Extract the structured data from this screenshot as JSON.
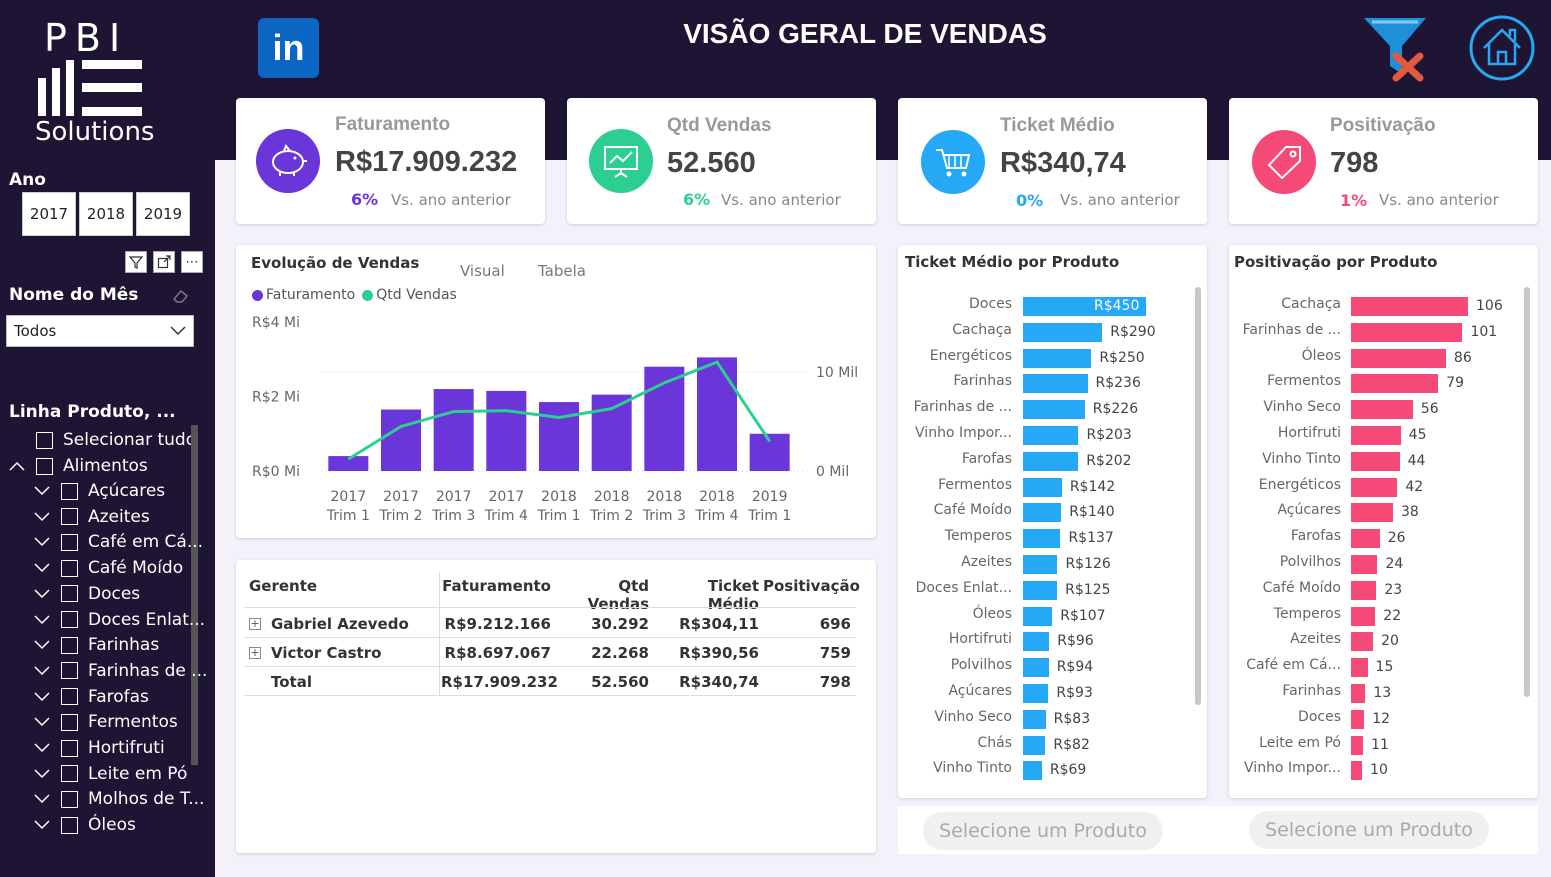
{
  "sidebar": {
    "logo_top": "PBI",
    "logo_bottom": "Solutions",
    "year_label": "Ano",
    "years": [
      "2017",
      "2018",
      "2019"
    ],
    "month_label": "Nome do Mês",
    "month_value": "Todos",
    "product_label": "Linha Produto, ...",
    "select_all": "Selecionar tudo",
    "group": "Alimentos",
    "items": [
      "Açúcares",
      "Azeites",
      "Café em Cá...",
      "Café Moído",
      "Doces",
      "Doces Enlat...",
      "Farinhas",
      "Farinhas de ...",
      "Farofas",
      "Fermentos",
      "Hortifruti",
      "Leite em Pó",
      "Molhos de T...",
      "Óleos"
    ]
  },
  "header": {
    "linkedin": "in",
    "title": "VISÃO GERAL DE VENDAS"
  },
  "kpis": [
    {
      "title": "Faturamento",
      "value": "R$17.909.232",
      "pct": "6%",
      "vs": "Vs. ano anterior",
      "color": "#6a35d9",
      "icon": "piggy-bank-icon"
    },
    {
      "title": "Qtd Vendas",
      "value": "52.560",
      "pct": "6%",
      "vs": "Vs. ano anterior",
      "color": "#2ccf8f",
      "icon": "presentation-chart-icon"
    },
    {
      "title": "Ticket Médio",
      "value": "R$340,74",
      "pct": "0%",
      "vs": "Vs. ano anterior",
      "color": "#25a8f5",
      "icon": "shopping-cart-icon"
    },
    {
      "title": "Positivação",
      "value": "798",
      "pct": "1%",
      "vs": "Vs. ano anterior",
      "color": "#f54a78",
      "icon": "price-tag-icon"
    }
  ],
  "evolution": {
    "title": "Evolução de Vendas",
    "tab_visual": "Visual",
    "tab_table": "Tabela",
    "legend": [
      "Faturamento",
      "Qtd Vendas"
    ]
  },
  "chart_data": {
    "type": "bar",
    "categories": [
      [
        "2017",
        "Trim 1"
      ],
      [
        "2017",
        "Trim 2"
      ],
      [
        "2017",
        "Trim 3"
      ],
      [
        "2017",
        "Trim 4"
      ],
      [
        "2018",
        "Trim 1"
      ],
      [
        "2018",
        "Trim 2"
      ],
      [
        "2018",
        "Trim 3"
      ],
      [
        "2018",
        "Trim 4"
      ],
      [
        "2019",
        "Trim 1"
      ]
    ],
    "series": [
      {
        "name": "Faturamento",
        "type": "bar",
        "axis": "left",
        "values": [
          0.4,
          1.65,
          2.2,
          2.15,
          1.85,
          2.05,
          2.8,
          3.05,
          1.0
        ]
      },
      {
        "name": "Qtd Vendas",
        "type": "line",
        "axis": "right",
        "values": [
          1.2,
          4.5,
          6.0,
          6.1,
          5.4,
          6.3,
          8.9,
          11.0,
          3.0
        ]
      }
    ],
    "left_ticks": [
      "R$0 Mi",
      "R$2 Mi",
      "R$4 Mi"
    ],
    "right_ticks": [
      "0 Mil",
      "10 Mil"
    ],
    "ylim_left": [
      0,
      4
    ],
    "ylim_right": [
      0,
      10
    ],
    "colors": {
      "bar": "#6a35d9",
      "line": "#2ccf8f"
    }
  },
  "table": {
    "headers": [
      "Gerente",
      "Faturamento",
      "Qtd Vendas",
      "Ticket Médio",
      "Positivação"
    ],
    "rows": [
      [
        "Gabriel Azevedo",
        "R$9.212.166",
        "30.292",
        "R$304,11",
        "696"
      ],
      [
        "Victor Castro",
        "R$8.697.067",
        "22.268",
        "R$390,56",
        "759"
      ]
    ],
    "total": [
      "Total",
      "R$17.909.232",
      "52.560",
      "R$340,74",
      "798"
    ]
  },
  "ticket_by_product": {
    "title": "Ticket Médio por Produto",
    "color": "#25a8f5",
    "items": [
      {
        "label": "Doces",
        "value": 450,
        "text": "R$450"
      },
      {
        "label": "Cachaça",
        "value": 290,
        "text": "R$290"
      },
      {
        "label": "Energéticos",
        "value": 250,
        "text": "R$250"
      },
      {
        "label": "Farinhas",
        "value": 236,
        "text": "R$236"
      },
      {
        "label": "Farinhas de ...",
        "value": 226,
        "text": "R$226"
      },
      {
        "label": "Vinho Impor...",
        "value": 203,
        "text": "R$203"
      },
      {
        "label": "Farofas",
        "value": 202,
        "text": "R$202"
      },
      {
        "label": "Fermentos",
        "value": 142,
        "text": "R$142"
      },
      {
        "label": "Café Moído",
        "value": 140,
        "text": "R$140"
      },
      {
        "label": "Temperos",
        "value": 137,
        "text": "R$137"
      },
      {
        "label": "Azeites",
        "value": 126,
        "text": "R$126"
      },
      {
        "label": "Doces Enlat...",
        "value": 125,
        "text": "R$125"
      },
      {
        "label": "Óleos",
        "value": 107,
        "text": "R$107"
      },
      {
        "label": "Hortifruti",
        "value": 96,
        "text": "R$96"
      },
      {
        "label": "Polvilhos",
        "value": 94,
        "text": "R$94"
      },
      {
        "label": "Açúcares",
        "value": 93,
        "text": "R$93"
      },
      {
        "label": "Vinho Seco",
        "value": 83,
        "text": "R$83"
      },
      {
        "label": "Chás",
        "value": 82,
        "text": "R$82"
      },
      {
        "label": "Vinho Tinto",
        "value": 69,
        "text": "R$69"
      }
    ]
  },
  "positivacao_by_product": {
    "title": "Positivação por Produto",
    "color": "#f54a78",
    "items": [
      {
        "label": "Cachaça",
        "value": 106,
        "text": "106"
      },
      {
        "label": "Farinhas de ...",
        "value": 101,
        "text": "101"
      },
      {
        "label": "Óleos",
        "value": 86,
        "text": "86"
      },
      {
        "label": "Fermentos",
        "value": 79,
        "text": "79"
      },
      {
        "label": "Vinho Seco",
        "value": 56,
        "text": "56"
      },
      {
        "label": "Hortifruti",
        "value": 45,
        "text": "45"
      },
      {
        "label": "Vinho Tinto",
        "value": 44,
        "text": "44"
      },
      {
        "label": "Energéticos",
        "value": 42,
        "text": "42"
      },
      {
        "label": "Açúcares",
        "value": 38,
        "text": "38"
      },
      {
        "label": "Farofas",
        "value": 26,
        "text": "26"
      },
      {
        "label": "Polvilhos",
        "value": 24,
        "text": "24"
      },
      {
        "label": "Café Moído",
        "value": 23,
        "text": "23"
      },
      {
        "label": "Temperos",
        "value": 22,
        "text": "22"
      },
      {
        "label": "Azeites",
        "value": 20,
        "text": "20"
      },
      {
        "label": "Café em Cá...",
        "value": 15,
        "text": "15"
      },
      {
        "label": "Farinhas",
        "value": 13,
        "text": "13"
      },
      {
        "label": "Doces",
        "value": 12,
        "text": "12"
      },
      {
        "label": "Leite em Pó",
        "value": 11,
        "text": "11"
      },
      {
        "label": "Vinho Impor...",
        "value": 10,
        "text": "10"
      }
    ]
  },
  "select_product": "Selecione um Produto"
}
